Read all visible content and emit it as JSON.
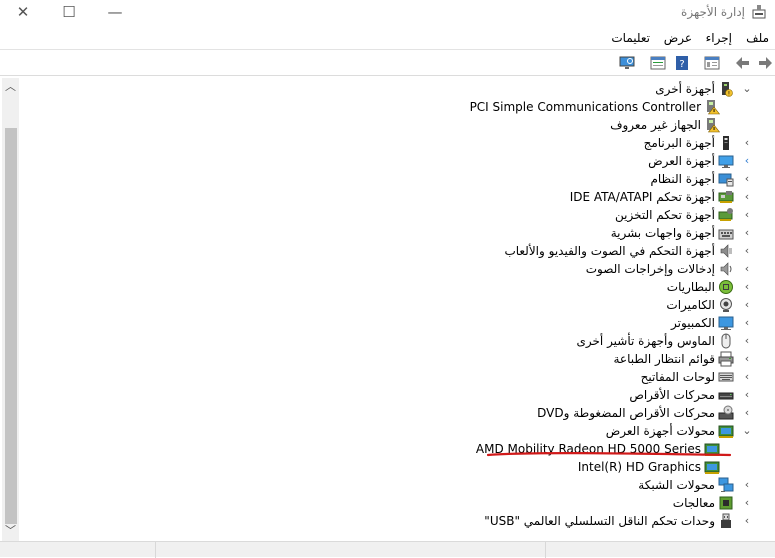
{
  "window": {
    "title": "إدارة الأجهزة",
    "minimize_glyph": "—",
    "maximize_glyph": "☐",
    "close_glyph": "✕"
  },
  "menu": {
    "file": "ملف",
    "action": "إجراء",
    "view": "عرض",
    "help": "تعليمات"
  },
  "toolbar_icons": [
    "back-icon",
    "forward-icon",
    "properties-icon",
    "help-icon",
    "details-icon",
    "monitor-icon"
  ],
  "tree": {
    "items": [
      {
        "label": "أجهزة أخرى",
        "icon": "unknown-device-icon",
        "expanded": true,
        "indent": 0
      },
      {
        "label": "PCI Simple Communications Controller",
        "icon": "warning-device-icon",
        "indent": 1
      },
      {
        "label": "الجهاز غير معروف",
        "icon": "warning-device-icon",
        "indent": 1
      },
      {
        "label": "أجهزة البرنامج",
        "icon": "software-device-icon",
        "indent": 0
      },
      {
        "label": "أجهزة العرض",
        "icon": "display-icon",
        "indent": 0
      },
      {
        "label": "أجهزة النظام",
        "icon": "system-device-icon",
        "indent": 0
      },
      {
        "label": "أجهزة تحكم IDE ATA/ATAPI",
        "icon": "ide-controller-icon",
        "indent": 0
      },
      {
        "label": "أجهزة تحكم التخزين",
        "icon": "storage-controller-icon",
        "indent": 0
      },
      {
        "label": "أجهزة واجهات بشرية",
        "icon": "hid-icon",
        "indent": 0
      },
      {
        "label": "أجهزة التحكم في الصوت والفيديو والألعاب",
        "icon": "sound-icon",
        "indent": 0
      },
      {
        "label": "إدخالات وإخراجات الصوت",
        "icon": "speaker-icon",
        "indent": 0
      },
      {
        "label": "البطاريات",
        "icon": "battery-icon",
        "indent": 0
      },
      {
        "label": "الكاميرات",
        "icon": "camera-icon",
        "indent": 0
      },
      {
        "label": "الكمبيوتر",
        "icon": "computer-icon",
        "indent": 0
      },
      {
        "label": "الماوس وأجهزة تأشير أخرى",
        "icon": "mouse-icon",
        "indent": 0
      },
      {
        "label": "قوائم انتظار الطباعة",
        "icon": "printer-icon",
        "indent": 0
      },
      {
        "label": "لوحات المفاتيح",
        "icon": "keyboard-icon",
        "indent": 0
      },
      {
        "label": "محركات الأقراص",
        "icon": "disk-drive-icon",
        "indent": 0
      },
      {
        "label": "محركات الأقراص المضغوطة وDVD",
        "icon": "dvd-drive-icon",
        "indent": 0
      },
      {
        "label": "محولات أجهزة العرض",
        "icon": "display-adapter-icon",
        "expanded": true,
        "indent": 0
      },
      {
        "label": "AMD Mobility Radeon HD 5000 Series",
        "icon": "display-adapter-icon",
        "indent": 1
      },
      {
        "label": "Intel(R) HD Graphics",
        "icon": "display-adapter-icon",
        "indent": 1
      },
      {
        "label": "محولات الشبكة",
        "icon": "network-adapter-icon",
        "indent": 0
      },
      {
        "label": "معالجات",
        "icon": "processor-icon",
        "indent": 0
      },
      {
        "label": "وحدات تحكم الناقل التسلسلي العالمي \"USB\"",
        "icon": "usb-icon",
        "indent": 0
      }
    ]
  },
  "expander_glyphs": {
    "collapsed": "‹",
    "expanded": "⌄"
  },
  "annotation_color": "#d11a1a"
}
